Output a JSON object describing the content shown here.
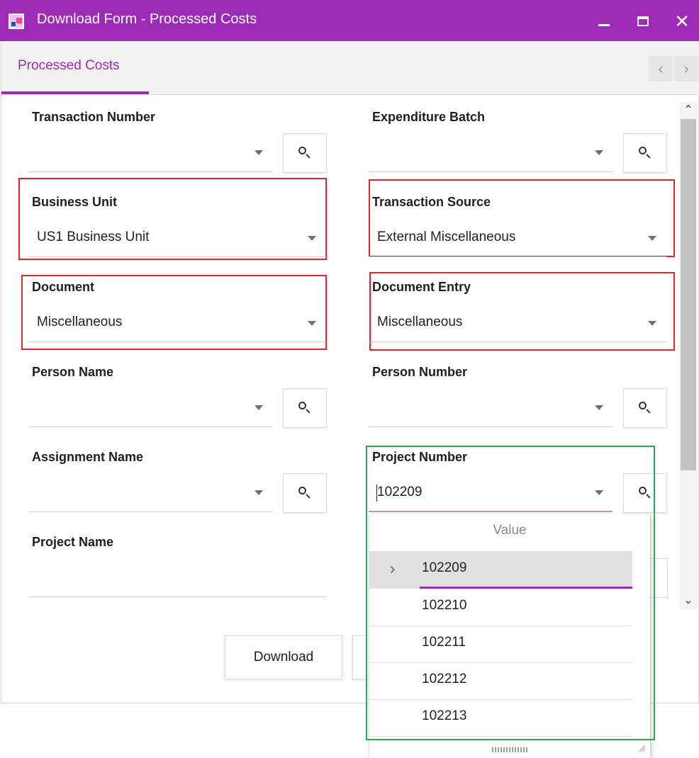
{
  "window": {
    "title": "Download Form - Processed Costs",
    "controls": {
      "minimize": "minimize",
      "maximize": "maximize",
      "close": "✕"
    }
  },
  "tabs": [
    {
      "label": "Processed Costs",
      "active": true
    }
  ],
  "tab_nav": {
    "prev": "‹",
    "next": "›"
  },
  "fields": {
    "transaction_number": {
      "label": "Transaction Number",
      "value": ""
    },
    "expenditure_batch": {
      "label": "Expenditure Batch",
      "value": ""
    },
    "business_unit": {
      "label": "Business Unit",
      "value": "US1 Business Unit"
    },
    "transaction_source": {
      "label": "Transaction Source",
      "value": "External Miscellaneous"
    },
    "document": {
      "label": "Document",
      "value": "Miscellaneous"
    },
    "document_entry": {
      "label": "Document Entry",
      "value": "Miscellaneous"
    },
    "person_name": {
      "label": "Person Name",
      "value": ""
    },
    "person_number": {
      "label": "Person Number",
      "value": ""
    },
    "assignment_name": {
      "label": "Assignment Name",
      "value": ""
    },
    "project_number": {
      "label": "Project Number",
      "value": "102209"
    },
    "project_name": {
      "label": "Project Name",
      "value": ""
    }
  },
  "buttons": {
    "download": "Download"
  },
  "dropdown": {
    "header": "Value",
    "items": [
      "102209",
      "102210",
      "102211",
      "102212",
      "102213"
    ],
    "selected": "102209"
  },
  "colors": {
    "accent": "#9d2bb8",
    "highlight_red": "#e0252b",
    "highlight_green": "#2fa84f"
  }
}
